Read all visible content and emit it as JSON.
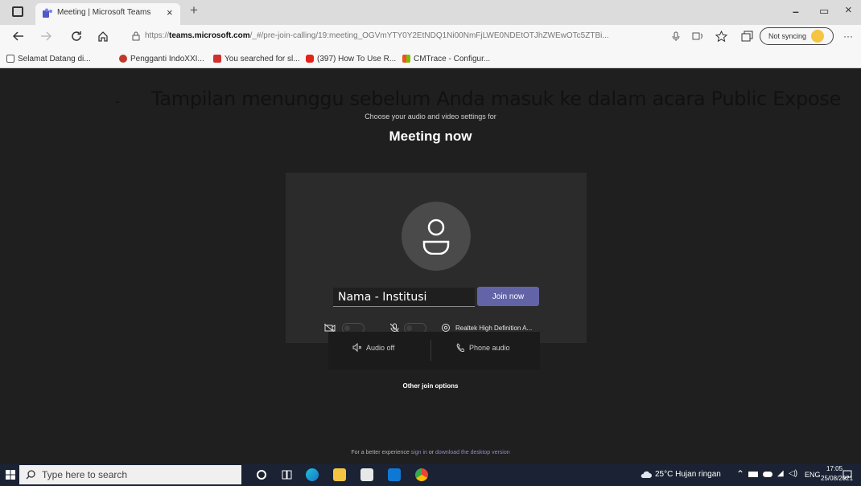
{
  "browser": {
    "tab_title": "Meeting | Microsoft Teams",
    "tab_close": "×",
    "new_tab": "+",
    "window_controls": {
      "minimize": "–",
      "restore": "▭",
      "close": "×"
    },
    "url_prefix": "https://",
    "url_host": "teams.microsoft.com",
    "url_path": "/_#/pre-join-calling/19:meeting_OGVmYTY0Y2EtNDQ1Ni00NmFjLWE0NDEtOTJhZWEwOTc5ZTBi...",
    "profile_label": "Not syncing",
    "more_menu": "···",
    "favorites": [
      {
        "label": "Selamat Datang di...",
        "icon": "page-icon",
        "color": "#ffffff"
      },
      {
        "label": "Pengganti IndoXXI...",
        "icon": "flower-icon",
        "color": "#c0392b"
      },
      {
        "label": "You searched for sl...",
        "icon": "app-icon",
        "color": "#d32f2f"
      },
      {
        "label": "(397) How To Use R...",
        "icon": "youtube-icon",
        "color": "#e62117"
      },
      {
        "label": "CMTrace - Configur...",
        "icon": "windows-icon",
        "color": "#f4b400"
      }
    ]
  },
  "content": {
    "overlay_dash": "-",
    "overlay_caption": "Tampilan menunggu sebelum Anda masuk ke dalam acara Public Expose",
    "subtitle": "Choose your audio and video settings for",
    "title": "Meeting now",
    "name_value": "Nama - Institusi",
    "join_label": "Join now",
    "device_label": "Realtek High Definition A...",
    "other_options_label": "Other join options",
    "audio_off_label": "Audio off",
    "phone_audio_label": "Phone audio",
    "better_prefix": "For a better experience ",
    "better_link1": "sign in",
    "better_mid": " or ",
    "better_link2": "download the desktop version"
  },
  "taskbar": {
    "search_placeholder": "Type here to search",
    "weather": "25°C  Hujan ringan",
    "language": "ENG",
    "time": "17:05",
    "date": "25/08/2021"
  },
  "colors": {
    "accent": "#6264a7",
    "background": "#1f1f1f",
    "card": "#2b2b2b"
  }
}
